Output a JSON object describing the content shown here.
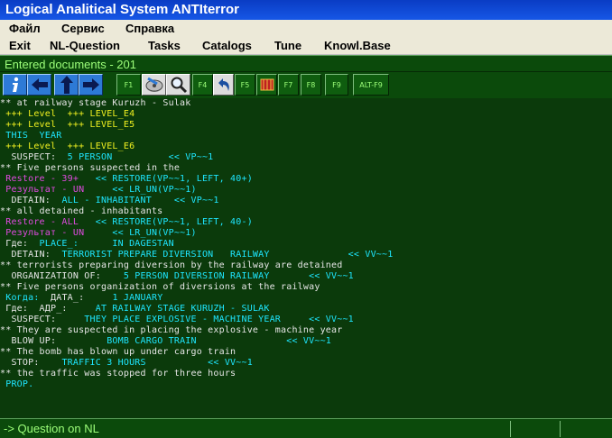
{
  "window": {
    "title": "Logical Analitical System ANTIterror"
  },
  "menu_row1": [
    "Файл",
    "Сервис",
    "Справка"
  ],
  "menu_row2": [
    "Exit",
    "NL-Question",
    "Tasks",
    "Catalogs",
    "Tune",
    "Knowl.Base"
  ],
  "doc_header": "Entered documents - 201",
  "toolbar": {
    "f1": "F1",
    "f4": "F4",
    "f5": "F5",
    "f7": "F7",
    "f8": "F8",
    "f9": "F9",
    "altf9": "ALT-F9",
    "icons": [
      "info-icon",
      "arrow-left-icon",
      "arrow-up-icon",
      "arrow-right-icon",
      "disk-icon",
      "magnifier-icon",
      "undo-arrow-icon",
      "book-icon"
    ],
    "icon_colors": {
      "blue": "#2d7ad6",
      "green": "#0f5d0f",
      "yellow": "#f0f020"
    }
  },
  "lines": [
    {
      "segs": [
        {
          "t": "** at railway stage Kuruzh - Sulak",
          "c": "w"
        }
      ]
    },
    {
      "segs": [
        {
          "t": " +++ Level  +++ LEVEL_E4",
          "c": "y"
        }
      ]
    },
    {
      "segs": [
        {
          "t": " +++ Level  +++ LEVEL_E5",
          "c": "y"
        }
      ]
    },
    {
      "segs": [
        {
          "t": " THIS  YEAR",
          "c": "c"
        }
      ]
    },
    {
      "segs": [
        {
          "t": " +++ Level  +++ LEVEL_E6",
          "c": "y"
        }
      ]
    },
    {
      "segs": [
        {
          "t": "  SUSPECT:  ",
          "c": "w"
        },
        {
          "t": "5 PERSON          << VP~~1",
          "c": "c"
        }
      ]
    },
    {
      "segs": [
        {
          "t": "** Five persons suspected in the",
          "c": "w"
        }
      ]
    },
    {
      "segs": [
        {
          "t": " Restore - 39+   ",
          "c": "m"
        },
        {
          "t": "<< RESTORE(VP~~1, LEFT, 40+)",
          "c": "c"
        }
      ]
    },
    {
      "segs": [
        {
          "t": " Результат - UN     ",
          "c": "m"
        },
        {
          "t": "<< LR_UN(VP~~1)",
          "c": "c"
        }
      ]
    },
    {
      "segs": [
        {
          "t": "  DETAIN:  ",
          "c": "w"
        },
        {
          "t": "ALL - INHABITANT    << VP~~1",
          "c": "c"
        }
      ]
    },
    {
      "segs": [
        {
          "t": "** all detained - inhabitants",
          "c": "w"
        }
      ]
    },
    {
      "segs": [
        {
          "t": " Restore - ALL   ",
          "c": "m"
        },
        {
          "t": "<< RESTORE(VP~~1, LEFT, 40-)",
          "c": "c"
        }
      ]
    },
    {
      "segs": [
        {
          "t": " Результат - UN     ",
          "c": "m"
        },
        {
          "t": "<< LR_UN(VP~~1)",
          "c": "c"
        }
      ]
    },
    {
      "segs": [
        {
          "t": " Где:  ",
          "c": "w"
        },
        {
          "t": "PLACE_:      IN DAGESTAN",
          "c": "c"
        }
      ]
    },
    {
      "segs": [
        {
          "t": "  DETAIN:  ",
          "c": "w"
        },
        {
          "t": "TERRORIST PREPARE DIVERSION   RAILWAY              << VV~~1",
          "c": "c"
        }
      ]
    },
    {
      "segs": [
        {
          "t": "** terrorists preparing diversion by the railway are detained",
          "c": "w"
        }
      ]
    },
    {
      "segs": [
        {
          "t": "  ORGANIZATION OF:    ",
          "c": "w"
        },
        {
          "t": "5 PERSON DIVERSION RAILWAY       << VV~~1",
          "c": "c"
        }
      ]
    },
    {
      "segs": [
        {
          "t": "** Five persons organization of diversions at the railway",
          "c": "w"
        }
      ]
    },
    {
      "segs": [
        {
          "t": " Когда:  ",
          "c": "c"
        },
        {
          "t": "ДАТА_:     ",
          "c": "w"
        },
        {
          "t": "1 JANUARY",
          "c": "c"
        }
      ]
    },
    {
      "segs": [
        {
          "t": " Где:  ",
          "c": "w"
        },
        {
          "t": "АДР_:     ",
          "c": "w"
        },
        {
          "t": "AT RAILWAY STAGE KURUZH - SULAK",
          "c": "c"
        }
      ]
    },
    {
      "segs": [
        {
          "t": "  SUSPECT:     ",
          "c": "w"
        },
        {
          "t": "THEY PLACE EXPLOSIVE - MACHINE YEAR     << VV~~1",
          "c": "c"
        }
      ]
    },
    {
      "segs": [
        {
          "t": "** They are suspected in placing the explosive - machine year",
          "c": "w"
        }
      ]
    },
    {
      "segs": [
        {
          "t": "  BLOW UP:         ",
          "c": "w"
        },
        {
          "t": "BOMB CARGO TRAIN                << VV~~1",
          "c": "c"
        }
      ]
    },
    {
      "segs": [
        {
          "t": "** The bomb has blown up under cargo train",
          "c": "w"
        }
      ]
    },
    {
      "segs": [
        {
          "t": "  STOP:    ",
          "c": "w"
        },
        {
          "t": "TRAFFIC 3 HOURS           << VV~~1",
          "c": "c"
        }
      ]
    },
    {
      "segs": [
        {
          "t": "** the traffic was stopped for three hours",
          "c": "w"
        }
      ]
    },
    {
      "segs": [
        {
          "t": " PROP.",
          "c": "c"
        }
      ]
    }
  ],
  "status": {
    "label": "-> Question on NL"
  }
}
